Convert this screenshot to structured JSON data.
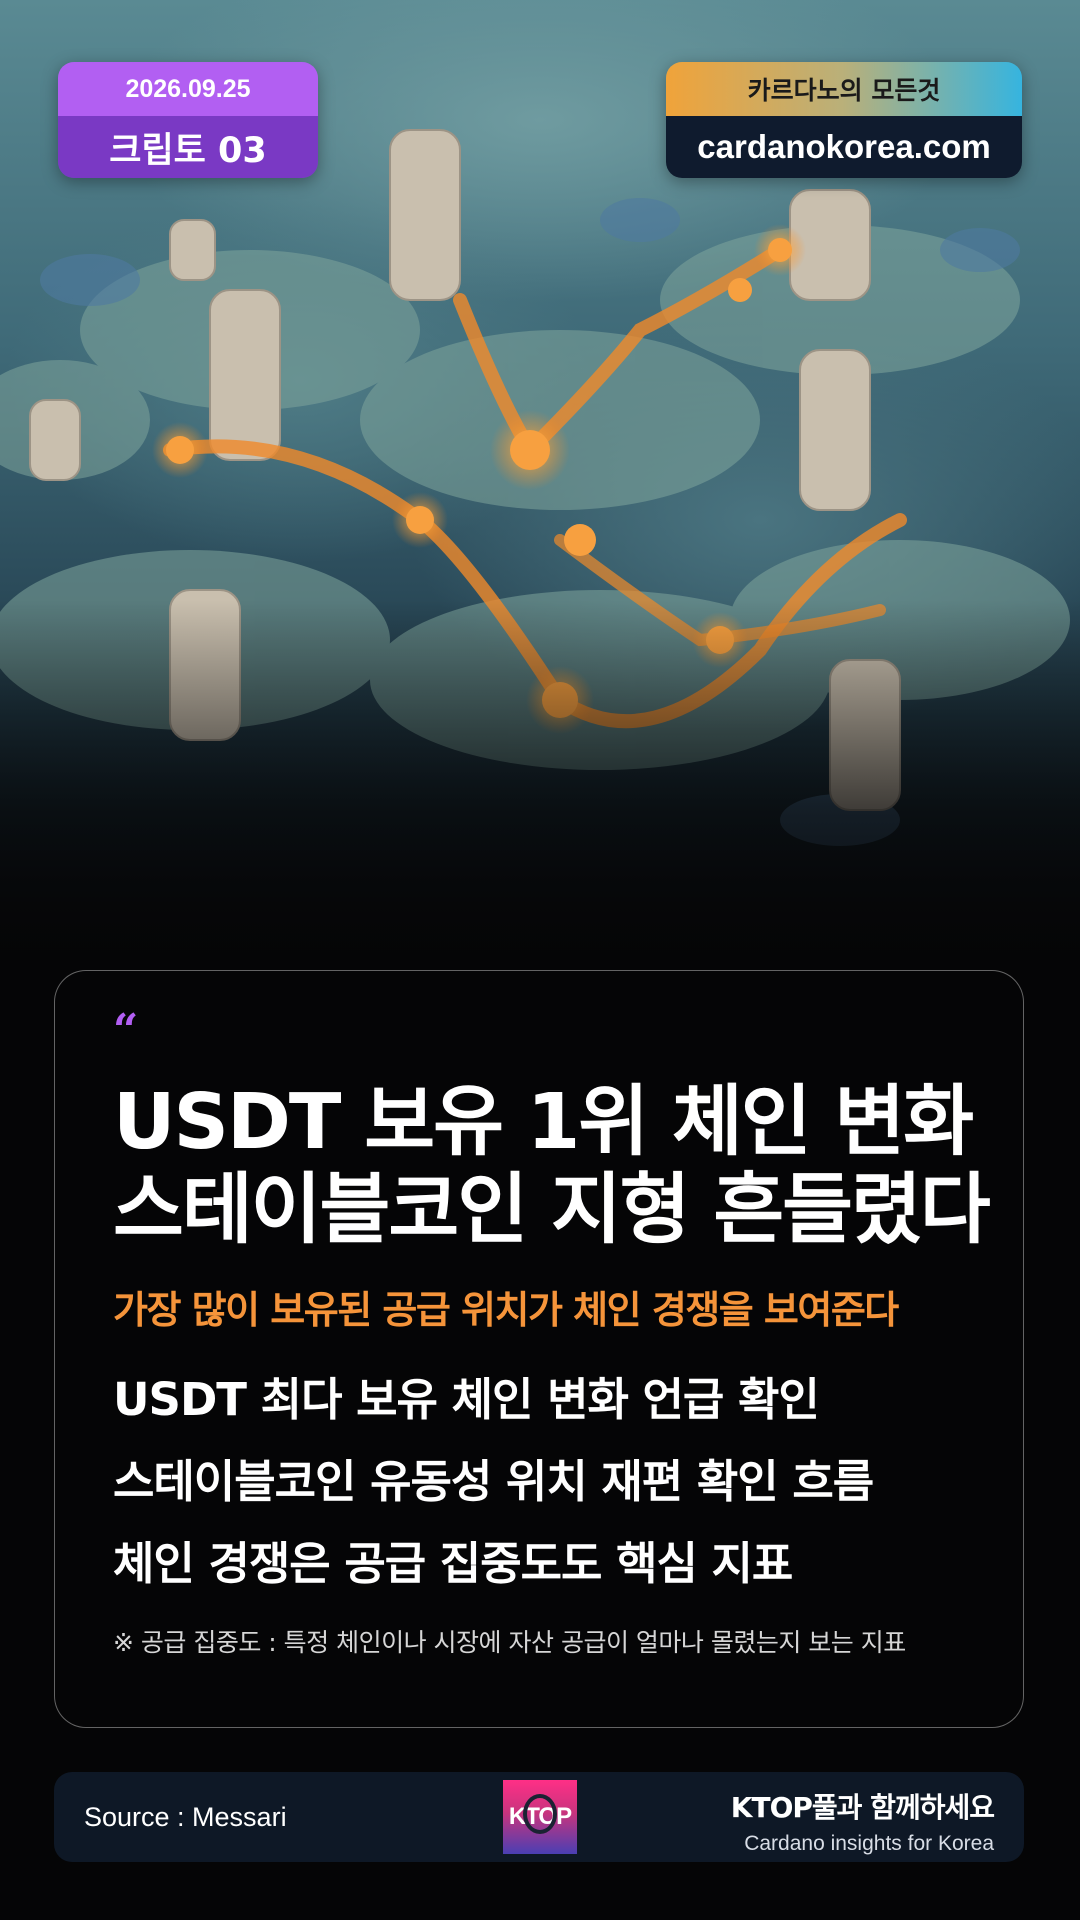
{
  "header": {
    "date": "2026.09.25",
    "series_label": "크립토 03",
    "site_tagline": "카르다노의 모든것",
    "site_url": "cardanokorea.com"
  },
  "card": {
    "quote_mark": "“",
    "headline_lines": [
      "USDT 보유 1위 체인 변화",
      "스테이블코인 지형 흔들렸다"
    ],
    "subheadline": "가장 많이 보유된 공급 위치가 체인 경쟁을 보여준다",
    "points": [
      "USDT 최다 보유 체인 변화 언급 확인",
      "스테이블코인 유동성 위치 재편 확인 흐름",
      "체인 경쟁은 공급 집중도도 핵심 지표"
    ],
    "footnote": "※ 공급 집중도 : 특정 체인이나 시장에 자산 공급이 얼마나 몰렸는지 보는 지표"
  },
  "footer": {
    "source": "Source : Messari",
    "logo_text": "KTOP",
    "brand_title": "KTOP풀과 함께하세요",
    "brand_subtitle": "Cardano insights for Korea"
  },
  "colors": {
    "accent_purple": "#b25ff2",
    "accent_orange": "#f5943a",
    "badge_dark": "#0f1b2e"
  }
}
